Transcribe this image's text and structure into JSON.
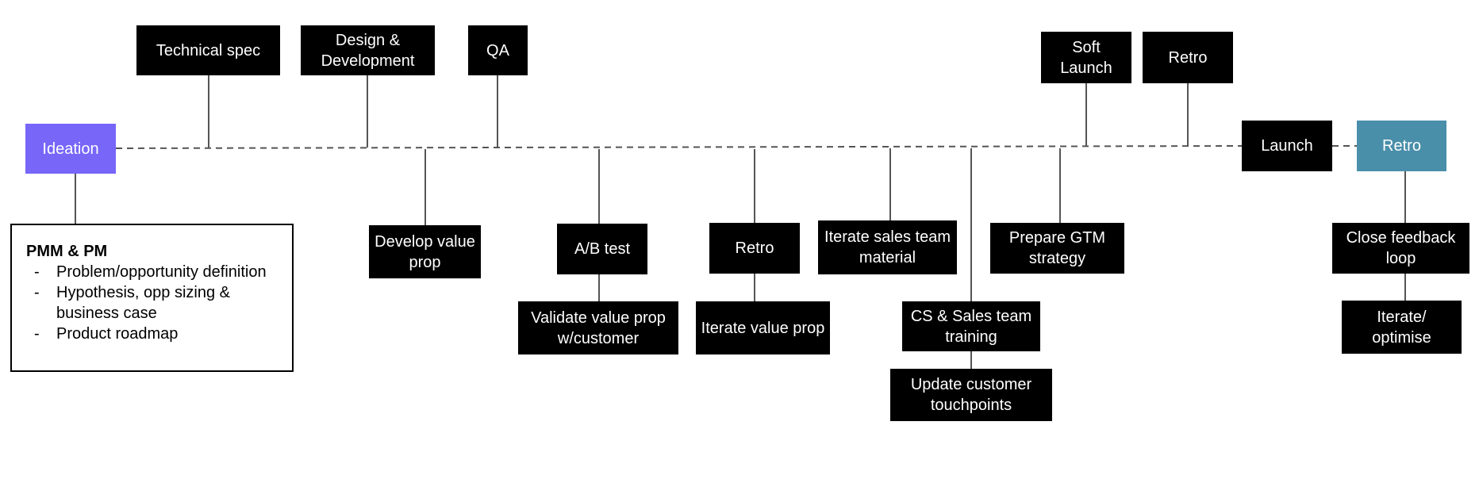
{
  "colors": {
    "ideation": "#7766f8",
    "final_retro": "#4a8faa",
    "step": "#000000"
  },
  "start": "Ideation",
  "owner_note": {
    "title": "PMM & PM",
    "items": [
      "Problem/opportunity definition",
      "Hypothesis, opp sizing & business case",
      "Product roadmap"
    ]
  },
  "above": {
    "technical_spec": "Technical spec",
    "design_dev": "Design & Development",
    "qa": "QA",
    "soft_launch": "Soft Launch",
    "retro": "Retro"
  },
  "below": {
    "develop_value_prop": "Develop value prop",
    "ab_test": "A/B test",
    "validate_value_prop": "Validate value prop w/customer",
    "retro": "Retro",
    "iterate_value_prop": "Iterate value prop",
    "iterate_sales_material": "Iterate sales team material",
    "cs_sales_training": "CS & Sales team training",
    "update_touchpoints": "Update customer touchpoints",
    "prepare_gtm": "Prepare GTM strategy",
    "close_feedback_loop": "Close feedback loop",
    "iterate_optimise": "Iterate/ optimise"
  },
  "launch": "Launch",
  "final_retro": "Retro"
}
